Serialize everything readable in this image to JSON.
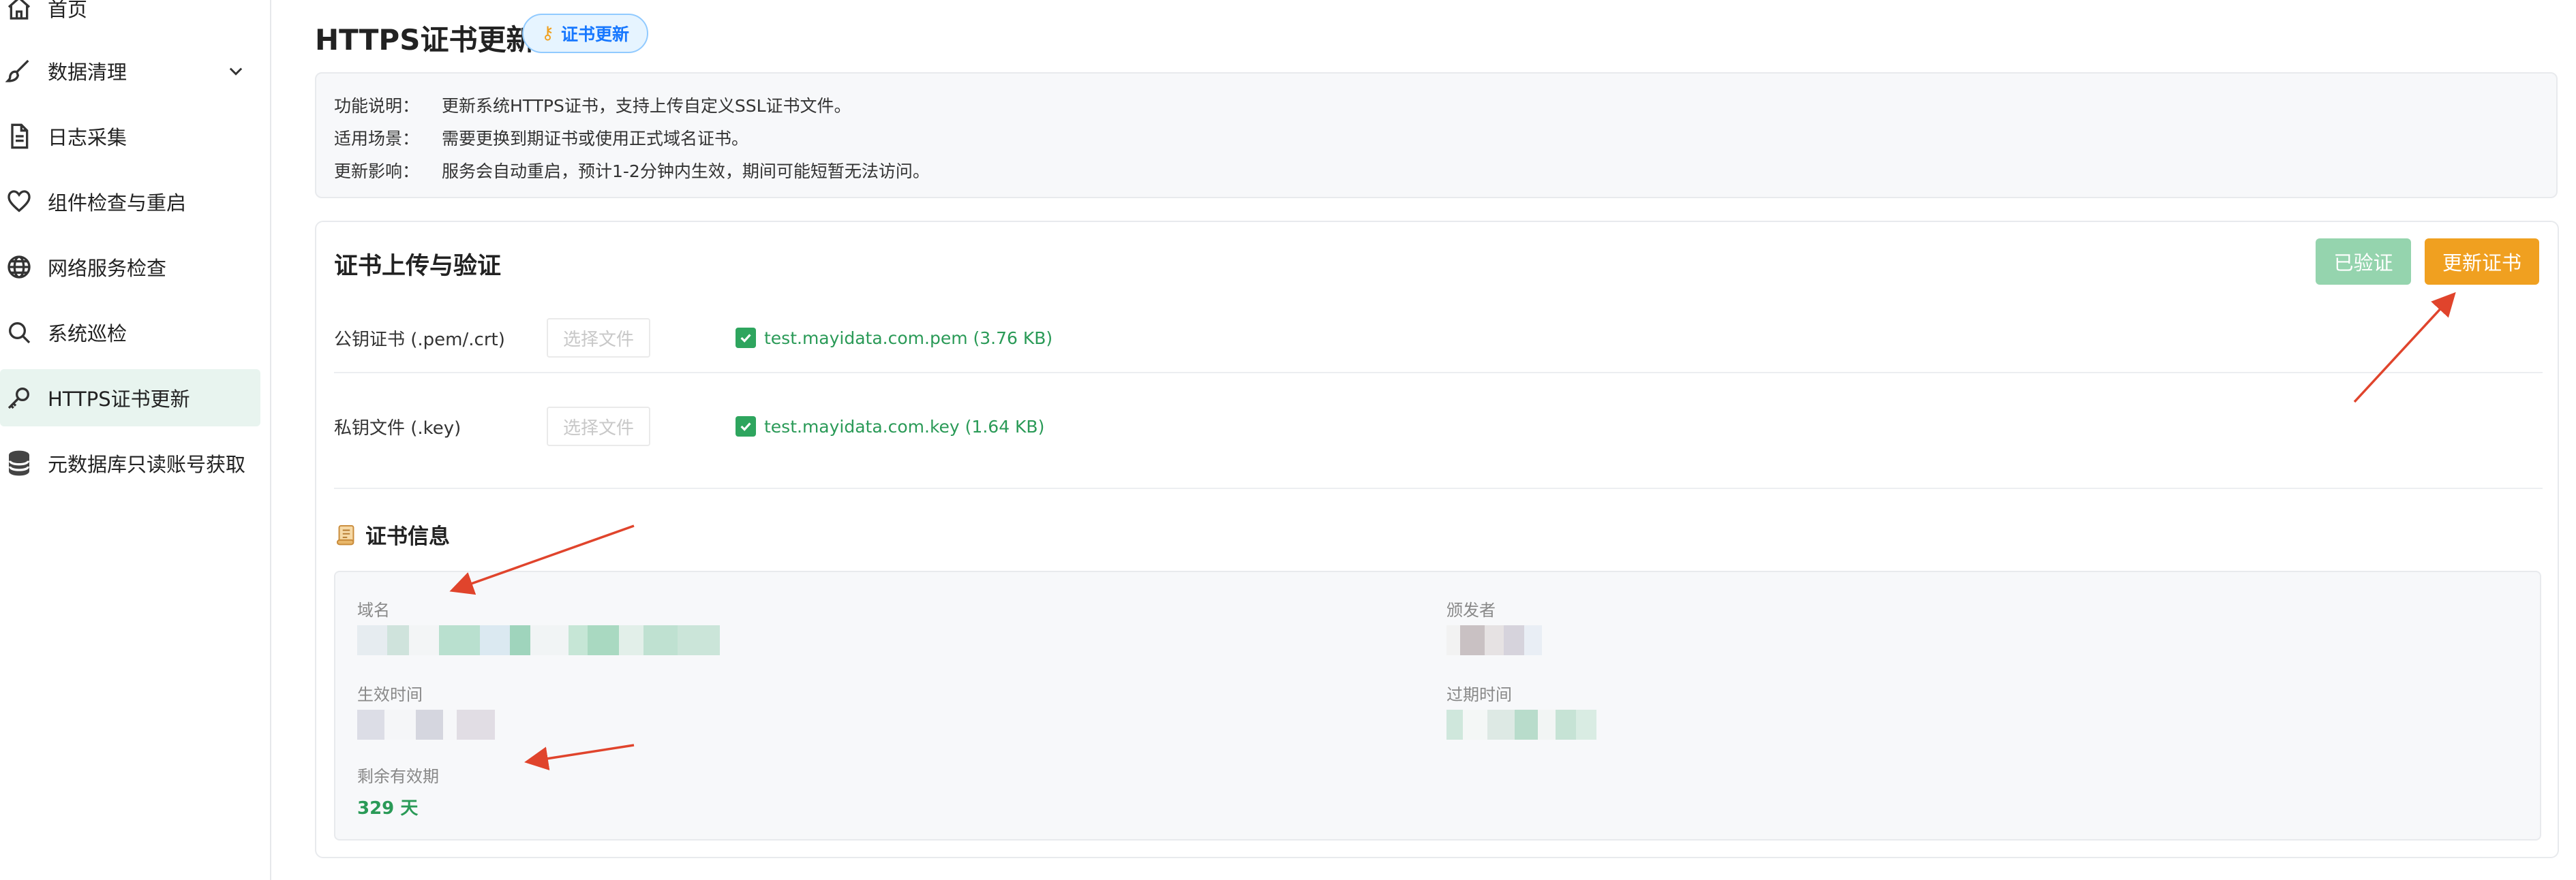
{
  "sidebar": {
    "items": [
      {
        "label": "首页",
        "icon": "home-icon"
      },
      {
        "label": "数据清理",
        "icon": "brush-icon",
        "has_children": true
      },
      {
        "label": "日志采集",
        "icon": "document-icon"
      },
      {
        "label": "组件检查与重启",
        "icon": "heart-icon"
      },
      {
        "label": "网络服务检查",
        "icon": "globe-icon"
      },
      {
        "label": "系统巡检",
        "icon": "search-icon"
      },
      {
        "label": "HTTPS证书更新",
        "icon": "key-icon",
        "active": true
      },
      {
        "label": "元数据库只读账号获取",
        "icon": "database-icon"
      }
    ]
  },
  "header": {
    "title": "HTTPS证书更新",
    "badge": "证书更新",
    "badge_icon": "key-icon"
  },
  "description": {
    "rows": [
      {
        "label": "功能说明：",
        "text": "更新系统HTTPS证书，支持上传自定义SSL证书文件。"
      },
      {
        "label": "适用场景：",
        "text": "需要更换到期证书或使用正式域名证书。"
      },
      {
        "label": "更新影响：",
        "text": "服务会自动重启，预计1-2分钟内生效，期间可能短暂无法访问。"
      }
    ]
  },
  "card": {
    "title": "证书上传与验证",
    "verified_button": "已验证",
    "update_button": "更新证书",
    "files": [
      {
        "label": "公钥证书 (.pem/.crt)",
        "picker": "选择文件",
        "filename": "test.mayidata.com.pem (3.76 KB)"
      },
      {
        "label": "私钥文件 (.key)",
        "picker": "选择文件",
        "filename": "test.mayidata.com.key (1.64 KB)"
      }
    ]
  },
  "cert_info": {
    "title": "证书信息",
    "domain_label": "域名",
    "issuer_label": "颁发者",
    "valid_from_label": "生效时间",
    "valid_to_label": "过期时间",
    "remaining_label": "剩余有效期",
    "remaining_value": "329 天"
  },
  "colors": {
    "accent_green": "#2a9a57",
    "verified_button": "#95d4ae",
    "update_button": "#f0a020",
    "annotation_arrow": "#e0442c",
    "active_nav_bg": "#e8f4ef"
  }
}
